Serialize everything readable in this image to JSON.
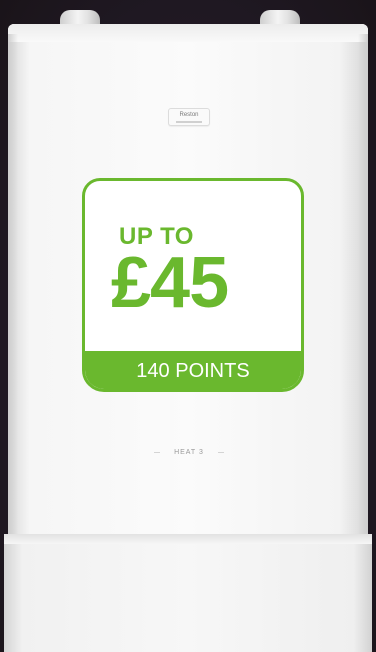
{
  "offer": {
    "headline": "UP TO",
    "amount": "£45",
    "points": "140 POINTS",
    "accent_color": "#6ab82e"
  },
  "product": {
    "brand_badge": "Reston",
    "model": "HEAT 3"
  },
  "colors": {
    "background": "#241c27",
    "boiler_body": "#f6f6f6"
  }
}
